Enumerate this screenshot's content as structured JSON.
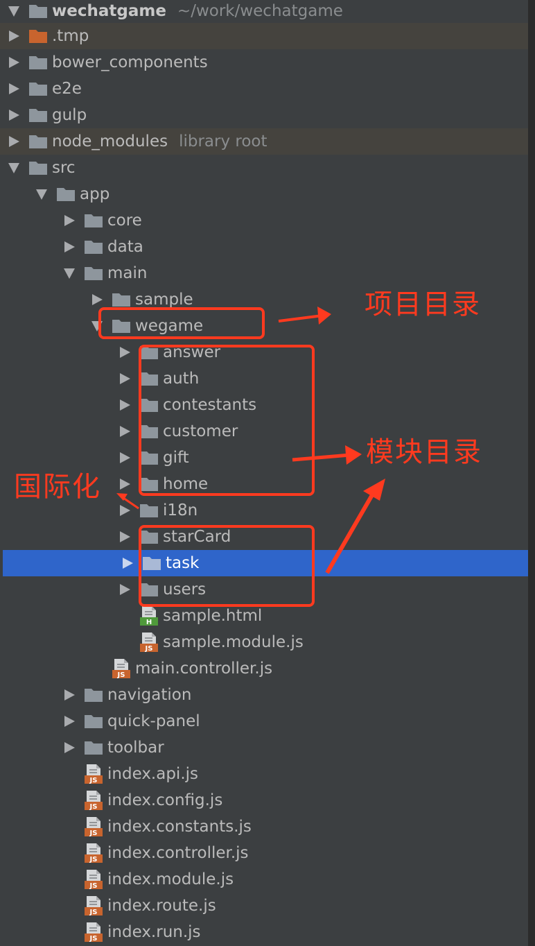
{
  "tree": {
    "root": {
      "name": "wechatgame",
      "path": "~/work/wechatgame"
    },
    "items": [
      {
        "label": ".tmp",
        "hint": "",
        "kind": "folder",
        "color": "#c8642e",
        "depth": 1,
        "state": "collapsed",
        "tinted": true
      },
      {
        "label": "bower_components",
        "hint": "",
        "kind": "folder",
        "depth": 1,
        "state": "collapsed"
      },
      {
        "label": "e2e",
        "hint": "",
        "kind": "folder",
        "depth": 1,
        "state": "collapsed"
      },
      {
        "label": "gulp",
        "hint": "",
        "kind": "folder",
        "depth": 1,
        "state": "collapsed"
      },
      {
        "label": "node_modules",
        "hint": "library root",
        "kind": "folder",
        "depth": 1,
        "state": "collapsed",
        "tinted": true
      },
      {
        "label": "src",
        "hint": "",
        "kind": "folder",
        "depth": 1,
        "state": "expanded"
      },
      {
        "label": "app",
        "hint": "",
        "kind": "folder",
        "depth": 2,
        "state": "expanded"
      },
      {
        "label": "core",
        "hint": "",
        "kind": "folder",
        "depth": 3,
        "state": "collapsed"
      },
      {
        "label": "data",
        "hint": "",
        "kind": "folder",
        "depth": 3,
        "state": "collapsed"
      },
      {
        "label": "main",
        "hint": "",
        "kind": "folder",
        "depth": 3,
        "state": "expanded"
      },
      {
        "label": "sample",
        "hint": "",
        "kind": "folder",
        "depth": 4,
        "state": "collapsed"
      },
      {
        "label": "wegame",
        "hint": "",
        "kind": "folder",
        "depth": 4,
        "state": "expanded"
      },
      {
        "label": "answer",
        "hint": "",
        "kind": "folder",
        "depth": 5,
        "state": "collapsed"
      },
      {
        "label": "auth",
        "hint": "",
        "kind": "folder",
        "depth": 5,
        "state": "collapsed"
      },
      {
        "label": "contestants",
        "hint": "",
        "kind": "folder",
        "depth": 5,
        "state": "collapsed"
      },
      {
        "label": "customer",
        "hint": "",
        "kind": "folder",
        "depth": 5,
        "state": "collapsed"
      },
      {
        "label": "gift",
        "hint": "",
        "kind": "folder",
        "depth": 5,
        "state": "collapsed"
      },
      {
        "label": "home",
        "hint": "",
        "kind": "folder",
        "depth": 5,
        "state": "collapsed"
      },
      {
        "label": "i18n",
        "hint": "",
        "kind": "folder",
        "depth": 5,
        "state": "collapsed"
      },
      {
        "label": "starCard",
        "hint": "",
        "kind": "folder",
        "depth": 5,
        "state": "collapsed"
      },
      {
        "label": "task",
        "hint": "",
        "kind": "folder",
        "depth": 5,
        "state": "collapsed",
        "selected": true
      },
      {
        "label": "users",
        "hint": "",
        "kind": "folder",
        "depth": 5,
        "state": "collapsed"
      },
      {
        "label": "sample.html",
        "hint": "",
        "kind": "file",
        "badge": "H",
        "badge_color": "#4f9a3b",
        "depth": 5,
        "state": "none"
      },
      {
        "label": "sample.module.js",
        "hint": "",
        "kind": "file",
        "badge": "JS",
        "badge_color": "#c8642e",
        "depth": 5,
        "state": "none"
      },
      {
        "label": "main.controller.js",
        "hint": "",
        "kind": "file",
        "badge": "JS",
        "badge_color": "#c8642e",
        "depth": 4,
        "state": "none"
      },
      {
        "label": "navigation",
        "hint": "",
        "kind": "folder",
        "depth": 3,
        "state": "collapsed"
      },
      {
        "label": "quick-panel",
        "hint": "",
        "kind": "folder",
        "depth": 3,
        "state": "collapsed"
      },
      {
        "label": "toolbar",
        "hint": "",
        "kind": "folder",
        "depth": 3,
        "state": "collapsed"
      },
      {
        "label": "index.api.js",
        "hint": "",
        "kind": "file",
        "badge": "JS",
        "badge_color": "#c8642e",
        "depth": 3,
        "state": "none"
      },
      {
        "label": "index.config.js",
        "hint": "",
        "kind": "file",
        "badge": "JS",
        "badge_color": "#c8642e",
        "depth": 3,
        "state": "none"
      },
      {
        "label": "index.constants.js",
        "hint": "",
        "kind": "file",
        "badge": "JS",
        "badge_color": "#c8642e",
        "depth": 3,
        "state": "none"
      },
      {
        "label": "index.controller.js",
        "hint": "",
        "kind": "file",
        "badge": "JS",
        "badge_color": "#c8642e",
        "depth": 3,
        "state": "none"
      },
      {
        "label": "index.module.js",
        "hint": "",
        "kind": "file",
        "badge": "JS",
        "badge_color": "#c8642e",
        "depth": 3,
        "state": "none"
      },
      {
        "label": "index.route.js",
        "hint": "",
        "kind": "file",
        "badge": "JS",
        "badge_color": "#c8642e",
        "depth": 3,
        "state": "none"
      },
      {
        "label": "index.run.js",
        "hint": "",
        "kind": "file",
        "badge": "JS",
        "badge_color": "#c8642e",
        "depth": 3,
        "state": "none"
      }
    ]
  },
  "annotations": {
    "project_dir": "项目目录",
    "module_dir": "模块目录",
    "i18n": "国际化",
    "color": "#ff3a1f"
  },
  "colors": {
    "background": "#3c3f41",
    "selection": "#2f65ca",
    "folder": "#8e969d"
  }
}
